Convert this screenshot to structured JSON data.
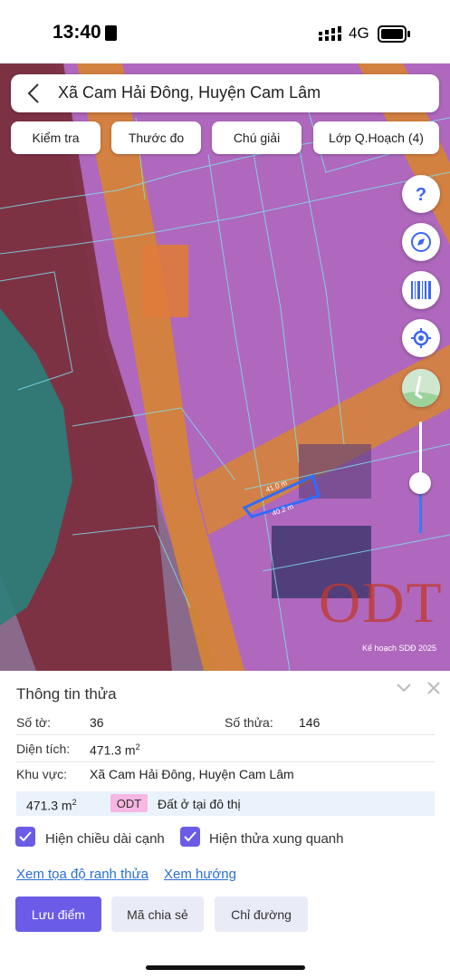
{
  "status_bar": {
    "time": "13:40",
    "network": "4G"
  },
  "header": {
    "title": "Xã Cam Hải Đông, Huyện Cam Lâm"
  },
  "toolbar": {
    "check": "Kiểm tra",
    "measure": "Thước đo",
    "legend": "Chú giải",
    "planning_layer": "Lớp Q.Hoạch (4)"
  },
  "map": {
    "zone_label": "ODT",
    "edge_top": "41.0 m",
    "edge_bottom": "40.2 m",
    "watermark": "Kế hoạch SDĐ 2025",
    "colors": {
      "road_orange": "#d9862b",
      "residential": "#b05cc0",
      "agri": "#7a2e3a",
      "water": "#2a7f7a",
      "parcel_outline": "#7fe3f0",
      "selected_parcel": "#2f6bff"
    },
    "side_buttons": [
      "help-icon",
      "compass-icon",
      "barcode-icon",
      "locate-icon",
      "map-layer-icon"
    ],
    "zoom_level": 0.55
  },
  "panel": {
    "title": "Thông tin thửa",
    "sheet_label": "Số tờ:",
    "sheet_value": "36",
    "parcel_label": "Số thửa:",
    "parcel_value": "146",
    "area_label": "Diện tích:",
    "area_value": "471.3 m",
    "area_sup": "2",
    "region_label": "Khu vực:",
    "region_value": "Xã Cam Hải Đông, Huyện Cam Lâm",
    "zone_area": "471.3 m",
    "zone_area_sup": "2",
    "zone_code": "ODT",
    "zone_desc": "Đất ở tại đô thị",
    "show_edges": "Hiện chiều dài cạnh",
    "show_surround": "Hiện thửa xung quanh",
    "link_coords": "Xem tọa độ ranh thửa",
    "link_direction": "Xem hướng",
    "btn_save": "Lưu điểm",
    "btn_share": "Mã chia sẻ",
    "btn_route": "Chỉ đường"
  }
}
